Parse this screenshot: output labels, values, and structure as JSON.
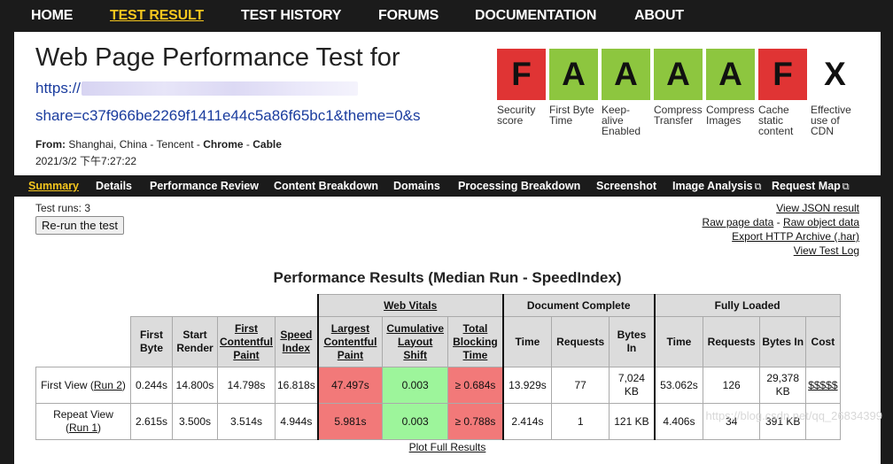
{
  "topnav": {
    "items": [
      {
        "label": "HOME"
      },
      {
        "label": "TEST RESULT"
      },
      {
        "label": "TEST HISTORY"
      },
      {
        "label": "FORUMS"
      },
      {
        "label": "DOCUMENTATION"
      },
      {
        "label": "ABOUT"
      }
    ],
    "active": "TEST RESULT"
  },
  "header": {
    "title": "Web Page Performance Test for",
    "url_line1": "https://",
    "url_line2": "share=c37f966be2269f1411e44c5a86f65bc1&theme=0&s",
    "from_label": "From:",
    "from_location": "Shanghai, China - Tencent - ",
    "from_browser": "Chrome",
    "from_sep": " - ",
    "from_connection": "Cable",
    "date": "2021/3/2 下午7:27:22"
  },
  "grades": [
    {
      "grade": "F",
      "label": "Security score",
      "color": "#e03434"
    },
    {
      "grade": "A",
      "label": "First Byte Time",
      "color": "#8dc63f"
    },
    {
      "grade": "A",
      "label": "Keep-alive Enabled",
      "color": "#8dc63f"
    },
    {
      "grade": "A",
      "label": "Compress Transfer",
      "color": "#8dc63f"
    },
    {
      "grade": "A",
      "label": "Compress Images",
      "color": "#8dc63f"
    },
    {
      "grade": "F",
      "label": "Cache static content",
      "color": "#e03434"
    },
    {
      "grade": "X",
      "label": "Effective use of CDN",
      "color": "#ffffff"
    }
  ],
  "subnav": {
    "items": [
      {
        "label": "Summary"
      },
      {
        "label": "Details"
      },
      {
        "label": "Performance Review"
      },
      {
        "label": "Content Breakdown"
      },
      {
        "label": "Domains"
      },
      {
        "label": "Processing Breakdown"
      },
      {
        "label": "Screenshot"
      },
      {
        "label": "Image Analysis"
      },
      {
        "label": "Request Map"
      }
    ],
    "active": "Summary",
    "external_icon": "external-link-icon"
  },
  "test_runs": "Test runs: 3",
  "rerun_button": "Re-run the test",
  "side_links": {
    "json": "View JSON result",
    "raw_page": "Raw page data",
    "raw_sep": " - ",
    "raw_object": "Raw object data",
    "har": "Export HTTP Archive (.har)",
    "log": "View Test Log"
  },
  "results": {
    "title": "Performance Results (Median Run - SpeedIndex)",
    "group_web_vitals": "Web Vitals",
    "group_doc_complete": "Document Complete",
    "group_fully_loaded": "Fully Loaded",
    "cols": {
      "first_byte": "First Byte",
      "start_render": "Start Render",
      "fcp": "First Contentful Paint",
      "speed_index": "Speed Index",
      "lcp": "Largest Contentful Paint",
      "cls": "Cumulative Layout Shift",
      "tbt": "Total Blocking Time",
      "dc_time": "Time",
      "dc_requests": "Requests",
      "dc_bytes": "Bytes In",
      "fl_time": "Time",
      "fl_requests": "Requests",
      "fl_bytes": "Bytes In",
      "cost": "Cost"
    },
    "rows": [
      {
        "label": "First View",
        "run": "Run 2",
        "first_byte": "0.244s",
        "start_render": "14.800s",
        "fcp": "14.798s",
        "speed_index": "16.818s",
        "lcp": "47.497s",
        "cls": "0.003",
        "tbt": "≥ 0.684s",
        "dc_time": "13.929s",
        "dc_requests": "77",
        "dc_bytes": "7,024 KB",
        "fl_time": "53.062s",
        "fl_requests": "126",
        "fl_bytes": "29,378 KB",
        "cost": "$$$$$"
      },
      {
        "label": "Repeat View",
        "run": "Run 1",
        "first_byte": "2.615s",
        "start_render": "3.500s",
        "fcp": "3.514s",
        "speed_index": "4.944s",
        "lcp": "5.981s",
        "cls": "0.003",
        "tbt": "≥ 0.788s",
        "dc_time": "2.414s",
        "dc_requests": "1",
        "dc_bytes": "121 KB",
        "fl_time": "4.406s",
        "fl_requests": "34",
        "fl_bytes": "391 KB",
        "cost": ""
      }
    ],
    "plot_link": "Plot Full Results"
  },
  "watermark": "https://blog.csdn.net/qq_26834399",
  "colors": {
    "nav_bg": "#1b1b1b",
    "active": "#f5c61e",
    "link_blue": "#1a3c9e",
    "grade_good": "#8dc63f",
    "grade_bad": "#e03434",
    "cell_bad": "#f27979",
    "cell_good": "#9df59b"
  }
}
